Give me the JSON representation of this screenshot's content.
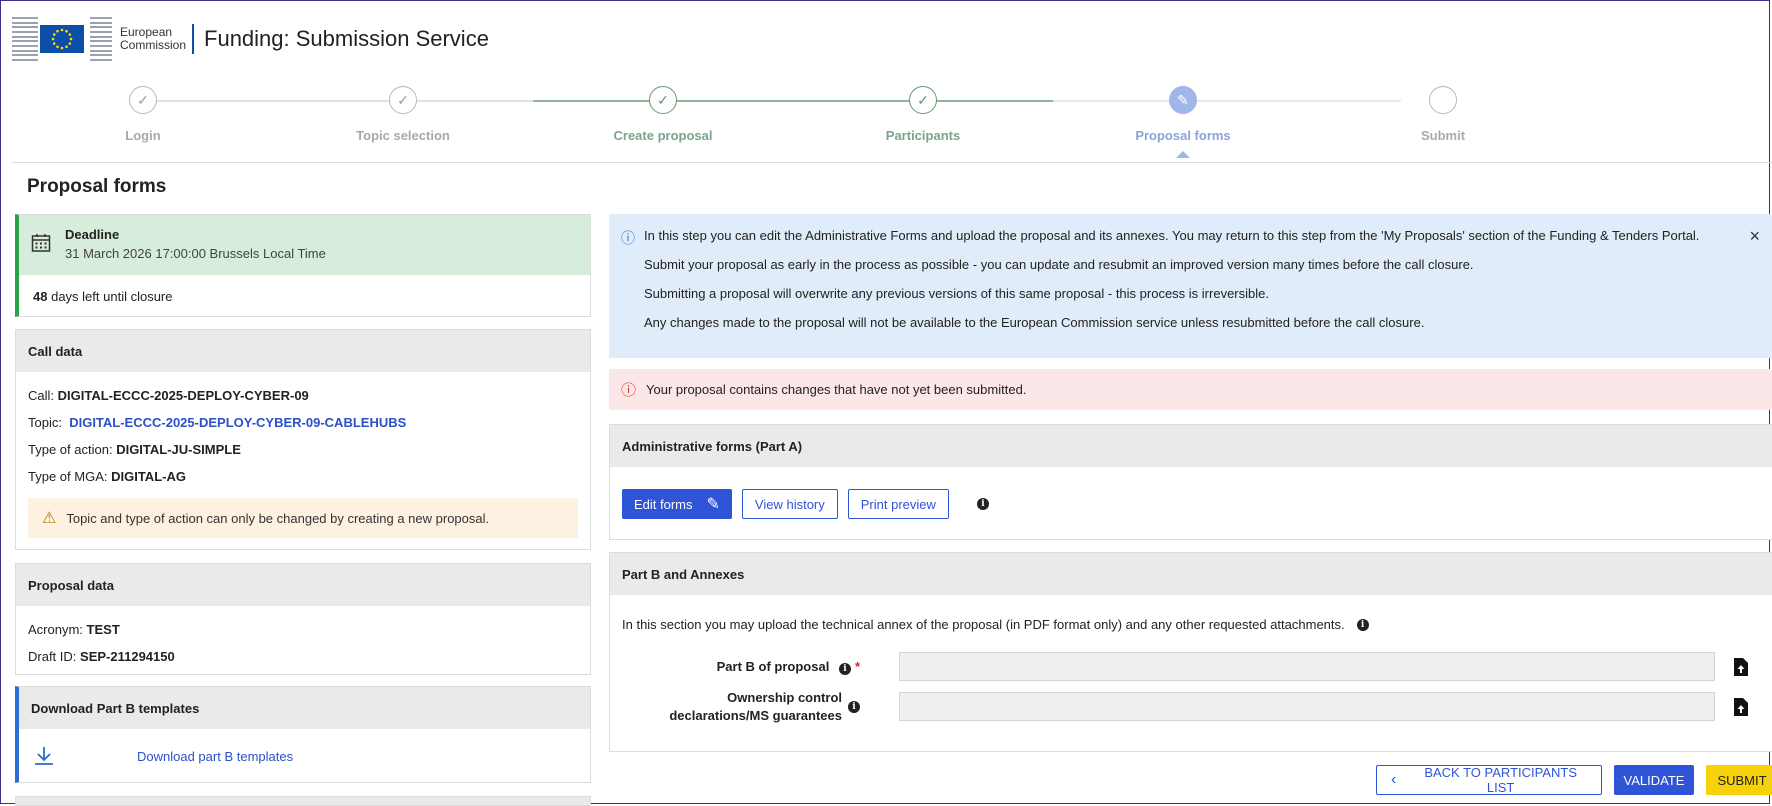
{
  "header": {
    "logo_line1": "European",
    "logo_line2": "Commission",
    "app_title": "Funding: Submission Service"
  },
  "stepper": {
    "steps": [
      {
        "label": "Login",
        "state": "done"
      },
      {
        "label": "Topic selection",
        "state": "done"
      },
      {
        "label": "Create proposal",
        "state": "done"
      },
      {
        "label": "Participants",
        "state": "done"
      },
      {
        "label": "Proposal forms",
        "state": "active"
      },
      {
        "label": "Submit",
        "state": "pending"
      }
    ]
  },
  "page_title": "Proposal forms",
  "deadline": {
    "title": "Deadline",
    "date": "31 March 2026 17:00:00 Brussels Local Time",
    "days_left": "48",
    "days_suffix": "days left until closure"
  },
  "call_data": {
    "title": "Call data",
    "call_label": "Call:",
    "call_value": "DIGITAL-ECCC-2025-DEPLOY-CYBER-09",
    "topic_label": "Topic:",
    "topic_value": "DIGITAL-ECCC-2025-DEPLOY-CYBER-09-CABLEHUBS",
    "action_label": "Type of action:",
    "action_value": "DIGITAL-JU-SIMPLE",
    "mga_label": "Type of MGA:",
    "mga_value": "DIGITAL-AG",
    "warning": "Topic and type of action can only be changed by creating a new proposal."
  },
  "proposal_data": {
    "title": "Proposal data",
    "acronym_label": "Acronym:",
    "acronym_value": "TEST",
    "draft_label": "Draft ID:",
    "draft_value": "SEP-211294150"
  },
  "download": {
    "title": "Download Part B templates",
    "link": "Download part B templates"
  },
  "info": {
    "line1": "In this step you can edit the Administrative Forms and upload the proposal and its annexes. You may return to this step from the 'My Proposals' section of the Funding & Tenders Portal.",
    "line2": "Submit your proposal as early in the process as possible - you can update and resubmit an improved version many times before the call closure.",
    "line3": "Submitting a proposal will overwrite any previous versions of this same proposal - this process is irreversible.",
    "line4": "Any changes made to the proposal will not be available to the European Commission service unless resubmitted before the call closure."
  },
  "error": "Your proposal contains changes that have not yet been submitted.",
  "admin_forms": {
    "title": "Administrative forms (Part A)",
    "edit": "Edit forms",
    "history": "View history",
    "preview": "Print preview"
  },
  "part_b": {
    "title": "Part B and Annexes",
    "description": "In this section you may upload the technical annex of the proposal (in PDF format only) and any other requested attachments.",
    "field1": "Part B of proposal",
    "field2": "Ownership control declarations/MS guarantees"
  },
  "actions": {
    "back": "BACK TO PARTICIPANTS LIST",
    "validate": "VALIDATE",
    "submit": "SUBMIT"
  },
  "colors": {
    "primary": "#2f54d6",
    "success": "#28a54b",
    "submit": "#f7d10a",
    "info_bg": "#e0ecf9",
    "error_bg": "#fbe7e7"
  }
}
